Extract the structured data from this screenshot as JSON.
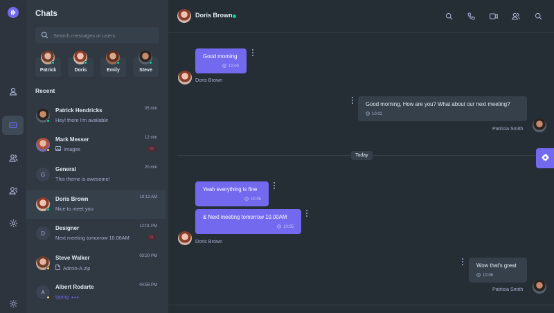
{
  "panel": {
    "title": "Chats",
    "search_placeholder": "Search messages or users",
    "recent_label": "Recent",
    "online": [
      {
        "name": "Patrick"
      },
      {
        "name": "Doris"
      },
      {
        "name": "Emily"
      },
      {
        "name": "Steve"
      }
    ],
    "chats": [
      {
        "name": "Patrick Hendricks",
        "message": "Hey! there I'm available",
        "time": "05 min",
        "status_color": "#06d6a0"
      },
      {
        "name": "Mark Messer",
        "message": "Images",
        "time": "12 min",
        "badge": "02",
        "status_color": "#ffd166"
      },
      {
        "name": "General",
        "initial": "G",
        "message": "This theme is awesome!",
        "time": "20 min"
      },
      {
        "name": "Doris Brown",
        "message": "Nice to meet you",
        "time": "10:12 AM",
        "status_color": "#06d6a0"
      },
      {
        "name": "Designer",
        "initial": "D",
        "message": "Next meeting tomorrow 10.00AM",
        "time": "12:01 PM",
        "badge": "01"
      },
      {
        "name": "Steve Walker",
        "message": "Admin-A.zip",
        "time": "03:20 PM",
        "status_color": "#ffd166"
      },
      {
        "name": "Albert Rodarte",
        "initial": "A",
        "message": "typing",
        "time": "04:56 PM",
        "status_color": "#ffd166"
      }
    ]
  },
  "conversation": {
    "contact_name": "Doris Brown",
    "today_label": "Today",
    "messages": [
      {
        "text": "Good morning",
        "time": "10:00",
        "sender": "Doris Brown"
      },
      {
        "text": "Good morning, How are you? What about our next meeting?",
        "time": "10:02",
        "sender": "Patricia Smith"
      },
      {
        "text": "Yeah everything is fine",
        "time": "10:05"
      },
      {
        "text": "& Next meeting tomorrow 10.00AM",
        "time": "10:05",
        "sender": "Doris Brown"
      },
      {
        "text": "Wow that's great",
        "time": "10:06",
        "sender": "Patricia Smith"
      }
    ]
  },
  "colors": {
    "accent": "#7269ef",
    "online": "#06d6a0",
    "away": "#ffd166",
    "badge_text": "#ef476f"
  }
}
